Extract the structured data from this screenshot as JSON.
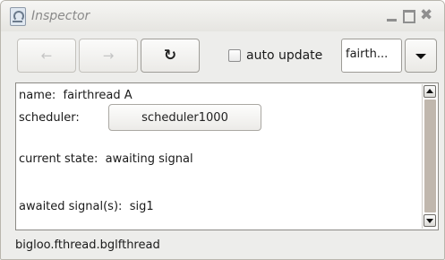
{
  "window": {
    "title": "Inspector",
    "controls": {
      "minimize": "minimize-icon",
      "maximize": "maximize-icon",
      "close": "close-icon"
    }
  },
  "toolbar": {
    "back_icon": "←",
    "forward_icon": "→",
    "reload_icon": "↻",
    "auto_update_label": "auto update",
    "auto_update_checked": false,
    "combo_value": "fairth..."
  },
  "inspector": {
    "name_label": "name:",
    "name_value": "fairthread A",
    "scheduler_label": "scheduler:",
    "scheduler_button": "scheduler1000",
    "state_label": "current state:",
    "state_value": "awaiting signal",
    "signals_label": "awaited signal(s):",
    "signals_value": "sig1"
  },
  "status_bar": {
    "class_name": "bigloo.fthread.bglfthread"
  },
  "colors": {
    "window_bg": "#ededeb",
    "panel_bg": "#ffffff",
    "scroll_thumb": "#c0b7ad"
  }
}
